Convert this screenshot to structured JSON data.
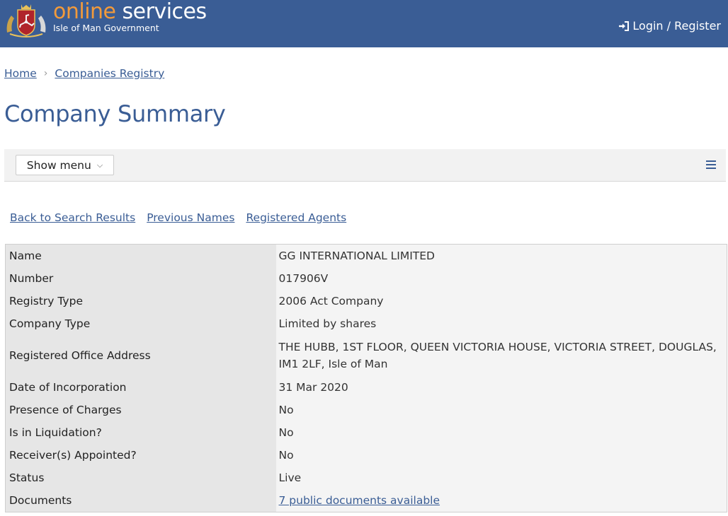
{
  "header": {
    "brand_online": "online",
    "brand_services": " services",
    "brand_subtitle": "Isle of Man Government",
    "login_label": "Login / Register",
    "background_color": "#3a5d95",
    "accent_color": "#f29a3b"
  },
  "breadcrumb": {
    "items": [
      "Home",
      "Companies Registry"
    ]
  },
  "page_title": "Company Summary",
  "menubar": {
    "show_menu_label": "Show menu"
  },
  "sublinks": [
    "Back to Search Results",
    "Previous Names",
    "Registered Agents"
  ],
  "details": [
    {
      "label": "Name",
      "value": "GG INTERNATIONAL LIMITED"
    },
    {
      "label": "Number",
      "value": "017906V"
    },
    {
      "label": "Registry Type",
      "value": "2006 Act Company"
    },
    {
      "label": "Company Type",
      "value": "Limited by shares"
    },
    {
      "label": "Registered Office Address",
      "value": "THE HUBB, 1ST FLOOR, QUEEN VICTORIA HOUSE, VICTORIA STREET, DOUGLAS, IM1 2LF, Isle of Man"
    },
    {
      "label": "Date of Incorporation",
      "value": "31 Mar 2020"
    },
    {
      "label": "Presence of Charges",
      "value": "No"
    },
    {
      "label": "Is in Liquidation?",
      "value": "No"
    },
    {
      "label": "Receiver(s) Appointed?",
      "value": "No"
    },
    {
      "label": "Status",
      "value": "Live"
    },
    {
      "label": "Documents",
      "value": "7 public documents available"
    }
  ]
}
